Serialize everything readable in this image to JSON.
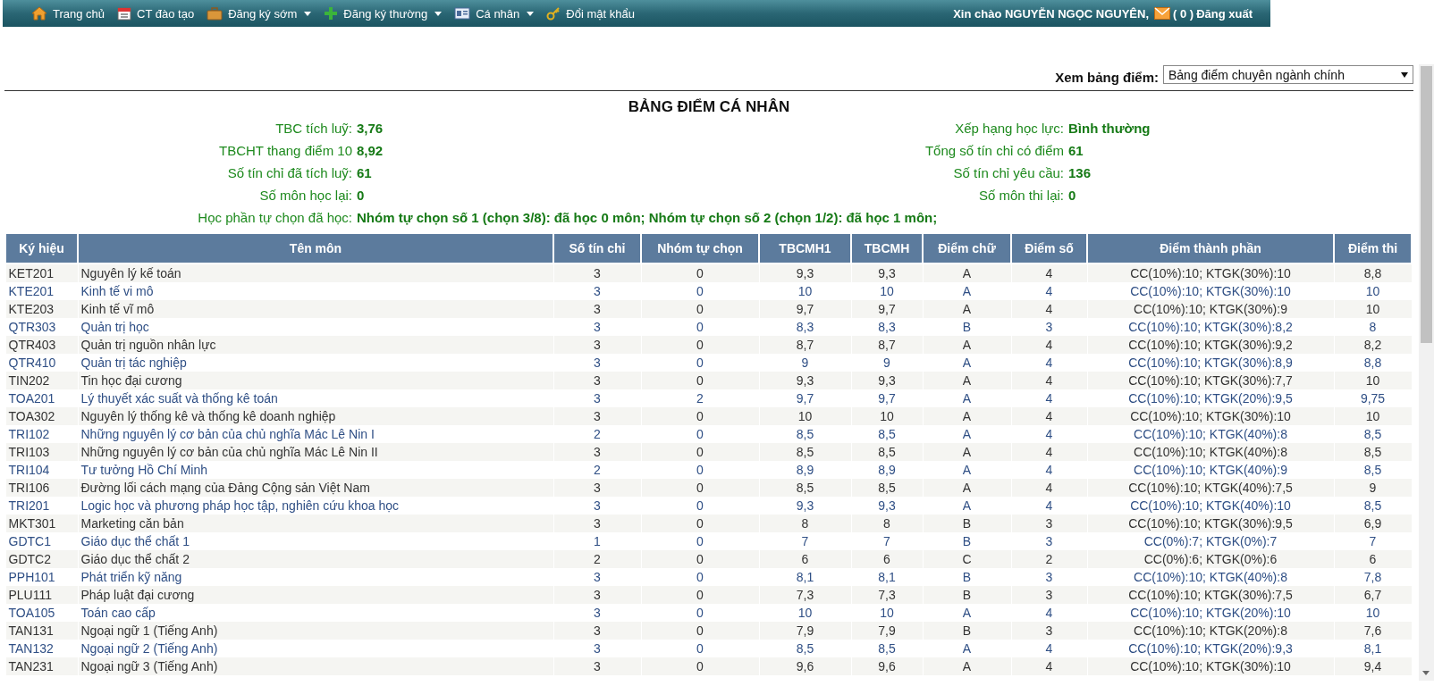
{
  "nav": {
    "items": [
      {
        "label": "Trang chủ",
        "has_menu": false
      },
      {
        "label": "CT đào tạo",
        "has_menu": false
      },
      {
        "label": "Đăng ký sớm",
        "has_menu": true
      },
      {
        "label": "Đăng ký thường",
        "has_menu": true
      },
      {
        "label": "Cá nhân",
        "has_menu": true
      },
      {
        "label": "Đổi mật khẩu",
        "has_menu": false
      }
    ],
    "greeting": "Xin chào NGUYỄN NGỌC NGUYÊN,",
    "mail_count": "( 0 )",
    "logout": "Đăng xuất"
  },
  "view_select": {
    "label": "Xem bảng điểm:",
    "value": "Bảng điểm chuyên ngành chính"
  },
  "title": "BẢNG ĐIỂM CÁ NHÂN",
  "summary": {
    "left": [
      {
        "label": "TBC tích luỹ:",
        "value": "3,76"
      },
      {
        "label": "TBCHT thang điểm 10",
        "value": "8,92"
      },
      {
        "label": "Số tín chỉ đã tích luỹ:",
        "value": "61"
      },
      {
        "label": "Số môn học lại:",
        "value": "0"
      }
    ],
    "right": [
      {
        "label": "Xếp hạng học lực:",
        "value": "Bình thường"
      },
      {
        "label": "Tổng số tín chỉ có điểm",
        "value": "61"
      },
      {
        "label": "Số tín chỉ yêu cầu:",
        "value": "136"
      },
      {
        "label": "Số môn thi lại:",
        "value": "0"
      }
    ],
    "electives": {
      "label": "Học phần tự chọn đã học:",
      "value": "Nhóm tự chọn số 1 (chọn 3/8): đã học 0 môn; Nhóm tự chọn số 2 (chọn 1/2): đã học 1 môn;"
    }
  },
  "table": {
    "columns": [
      "Ký hiệu",
      "Tên môn",
      "Số tín chỉ",
      "Nhóm tự chọn",
      "TBCMH1",
      "TBCMH",
      "Điểm chữ",
      "Điểm số",
      "Điểm thành phần",
      "Điểm thi"
    ],
    "rows": [
      [
        "KET201",
        "Nguyên lý kế toán",
        "3",
        "0",
        "9,3",
        "9,3",
        "A",
        "4",
        "CC(10%):10; KTGK(30%):10",
        "8,8"
      ],
      [
        "KTE201",
        "Kinh tế vi mô",
        "3",
        "0",
        "10",
        "10",
        "A",
        "4",
        "CC(10%):10; KTGK(30%):10",
        "10"
      ],
      [
        "KTE203",
        "Kinh tế vĩ mô",
        "3",
        "0",
        "9,7",
        "9,7",
        "A",
        "4",
        "CC(10%):10; KTGK(30%):9",
        "10"
      ],
      [
        "QTR303",
        "Quản trị học",
        "3",
        "0",
        "8,3",
        "8,3",
        "B",
        "3",
        "CC(10%):10; KTGK(30%):8,2",
        "8"
      ],
      [
        "QTR403",
        "Quản trị nguồn nhân lực",
        "3",
        "0",
        "8,7",
        "8,7",
        "A",
        "4",
        "CC(10%):10; KTGK(30%):9,2",
        "8,2"
      ],
      [
        "QTR410",
        "Quản trị tác nghiệp",
        "3",
        "0",
        "9",
        "9",
        "A",
        "4",
        "CC(10%):10; KTGK(30%):8,9",
        "8,8"
      ],
      [
        "TIN202",
        "Tin học đại cương",
        "3",
        "0",
        "9,3",
        "9,3",
        "A",
        "4",
        "CC(10%):10; KTGK(30%):7,7",
        "10"
      ],
      [
        "TOA201",
        "Lý thuyết xác suất và thống kê toán",
        "3",
        "2",
        "9,7",
        "9,7",
        "A",
        "4",
        "CC(10%):10; KTGK(20%):9,5",
        "9,75"
      ],
      [
        "TOA302",
        "Nguyên lý thống kê và thống kê doanh nghiệp",
        "3",
        "0",
        "10",
        "10",
        "A",
        "4",
        "CC(10%):10; KTGK(30%):10",
        "10"
      ],
      [
        "TRI102",
        "Những nguyên lý cơ bản của chủ nghĩa Mác Lê Nin I",
        "2",
        "0",
        "8,5",
        "8,5",
        "A",
        "4",
        "CC(10%):10; KTGK(40%):8",
        "8,5"
      ],
      [
        "TRI103",
        "Những nguyên lý cơ bản của chủ nghĩa Mác Lê Nin II",
        "3",
        "0",
        "8,5",
        "8,5",
        "A",
        "4",
        "CC(10%):10; KTGK(40%):8",
        "8,5"
      ],
      [
        "TRI104",
        "Tư tưởng Hồ Chí Minh",
        "2",
        "0",
        "8,9",
        "8,9",
        "A",
        "4",
        "CC(10%):10; KTGK(40%):9",
        "8,5"
      ],
      [
        "TRI106",
        "Đường lối cách mạng của Đảng Cộng sản Việt Nam",
        "3",
        "0",
        "8,5",
        "8,5",
        "A",
        "4",
        "CC(10%):10; KTGK(40%):7,5",
        "9"
      ],
      [
        "TRI201",
        "Logic học và phương pháp học tập, nghiên cứu khoa học",
        "3",
        "0",
        "9,3",
        "9,3",
        "A",
        "4",
        "CC(10%):10; KTGK(40%):10",
        "8,5"
      ],
      [
        "MKT301",
        "Marketing căn bản",
        "3",
        "0",
        "8",
        "8",
        "B",
        "3",
        "CC(10%):10; KTGK(30%):9,5",
        "6,9"
      ],
      [
        "GDTC1",
        "Giáo dục thể chất 1",
        "1",
        "0",
        "7",
        "7",
        "B",
        "3",
        "CC(0%):7; KTGK(0%):7",
        "7"
      ],
      [
        "GDTC2",
        "Giáo dục thể chất 2",
        "2",
        "0",
        "6",
        "6",
        "C",
        "2",
        "CC(0%):6; KTGK(0%):6",
        "6"
      ],
      [
        "PPH101",
        "Phát triển kỹ năng",
        "3",
        "0",
        "8,1",
        "8,1",
        "B",
        "3",
        "CC(10%):10; KTGK(40%):8",
        "7,8"
      ],
      [
        "PLU111",
        "Pháp luật đại cương",
        "3",
        "0",
        "7,3",
        "7,3",
        "B",
        "3",
        "CC(10%):10; KTGK(30%):7,5",
        "6,7"
      ],
      [
        "TOA105",
        "Toán cao cấp",
        "3",
        "0",
        "10",
        "10",
        "A",
        "4",
        "CC(10%):10; KTGK(20%):10",
        "10"
      ],
      [
        "TAN131",
        "Ngoại ngữ 1 (Tiếng Anh)",
        "3",
        "0",
        "7,9",
        "7,9",
        "B",
        "3",
        "CC(10%):10; KTGK(20%):8",
        "7,6"
      ],
      [
        "TAN132",
        "Ngoại ngữ 2 (Tiếng Anh)",
        "3",
        "0",
        "8,5",
        "8,5",
        "A",
        "4",
        "CC(10%):10; KTGK(20%):9,3",
        "8,1"
      ],
      [
        "TAN231",
        "Ngoại ngữ 3 (Tiếng Anh)",
        "3",
        "0",
        "9,6",
        "9,6",
        "A",
        "4",
        "CC(10%):10; KTGK(30%):10",
        "9,4"
      ]
    ]
  }
}
